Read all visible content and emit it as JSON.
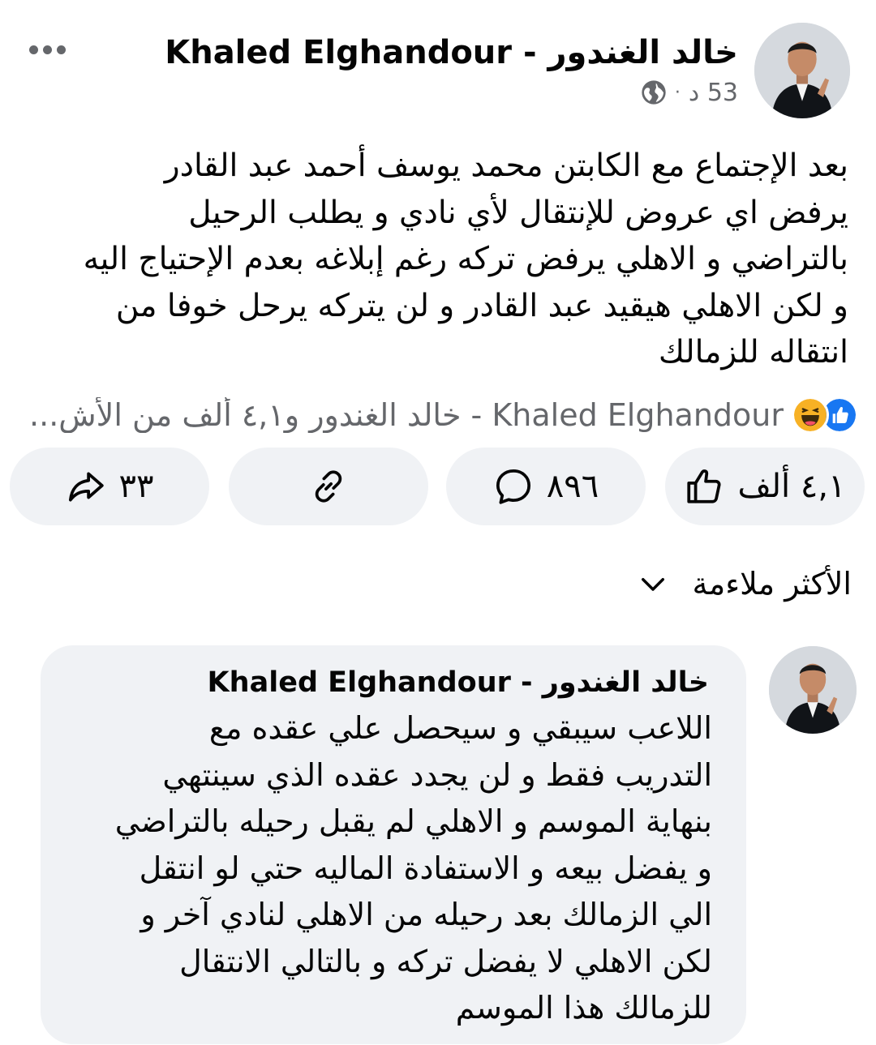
{
  "post": {
    "author": "خالد الغندور - Khaled Elghandour",
    "time": "53 د",
    "separator": "·",
    "privacy_icon": "globe-icon",
    "text": "بعد الإجتماع مع الكابتن محمد يوسف   أحمد عبد القادر\nيرفض اي عروض للإنتقال لأي نادي و يطلب الرحيل\nبالتراضي و الاهلي يرفض تركه رغم  إبلاغه بعدم الإحتياج اليه\nو لكن الاهلي هيقيد  عبد القادر و لن يتركه يرحل خوفا من\nانتقاله للزمالك",
    "reactions": {
      "icons": [
        "like-icon",
        "haha-icon"
      ],
      "summary": "Khaled Elghandour - خالد الغندور و٤,١ ألف من الأش..."
    },
    "actions": {
      "like_count": "٤,١ ألف",
      "comment_count": "٨٩٦",
      "share_count": "٣٣"
    }
  },
  "sort": {
    "label": "الأكثر ملاءمة"
  },
  "comment": {
    "author": "خالد الغندور - Khaled Elghandour",
    "text": "اللاعب سيبقي و سيحصل علي عقده مع\nالتدريب فقط و لن يجدد عقده الذي سينتهي\nبنهاية الموسم و الاهلي لم يقبل رحيله بالتراضي\nو يفضل بيعه و الاستفادة الماليه حتي لو انتقل\nالي الزمالك بعد رحيله من الاهلي لنادي آخر و\nلكن الاهلي لا يفضل تركه و بالتالي الانتقال\nللزمالك هذا الموسم"
  },
  "colors": {
    "like_blue": "#1877f2",
    "haha_yellow": "#f7b125",
    "secondary_text": "#65676b",
    "bubble_bg": "#f0f2f5"
  }
}
